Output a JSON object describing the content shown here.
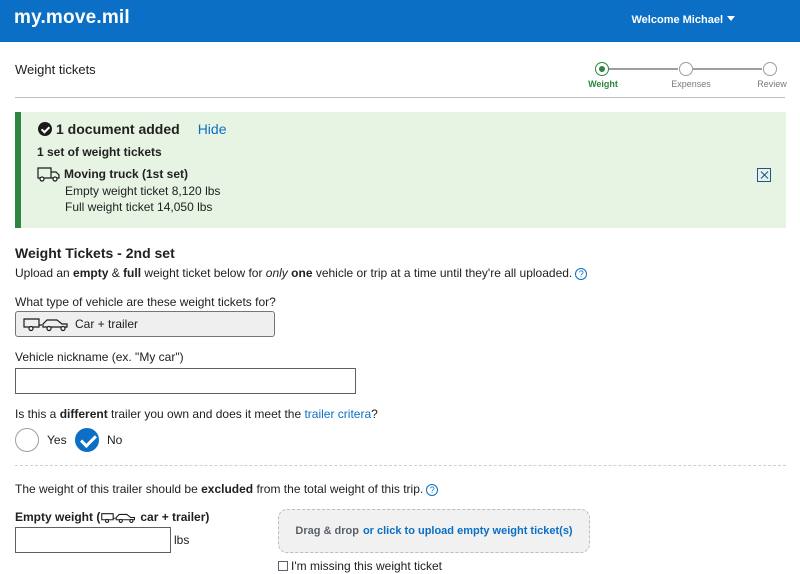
{
  "header": {
    "brand": "my.move.mil",
    "welcome": "Welcome Michael",
    "background_color": "#0b6fc5"
  },
  "page": {
    "title": "Weight tickets"
  },
  "stepper": {
    "steps": [
      {
        "label": "Weight",
        "state": "active"
      },
      {
        "label": "Expenses",
        "state": "pending"
      },
      {
        "label": "Review",
        "state": "pending"
      }
    ],
    "active_color": "#2e8540"
  },
  "alert": {
    "heading": "1 document added",
    "hide_link": "Hide",
    "subheading": "1 set of weight tickets",
    "item": {
      "icon": "truck-icon",
      "title": "Moving truck (1st set)",
      "empty_ticket": "Empty weight ticket 8,120 lbs",
      "full_ticket": "Full weight ticket 14,050 lbs"
    },
    "background_color": "#e7f4e4"
  },
  "form": {
    "section_title": "Weight Tickets - 2nd set",
    "instructions": {
      "part1": "Upload an ",
      "empty": "empty",
      "amp": " & ",
      "full": "full",
      "part2": " weight ticket below for ",
      "only": "only",
      "space": " ",
      "one": "one",
      "part3": " vehicle or trip at a time until they're all uploaded."
    },
    "vehicle_type_label": "What type of vehicle are these weight tickets for?",
    "vehicle_type_value": "Car + trailer",
    "nickname_label": "Vehicle nickname (ex. \"My car\")",
    "nickname_value": "",
    "trailer_question": {
      "part1": "Is this a ",
      "different": "different",
      "part2": " trailer you own and does it meet the ",
      "link": "trailer critera",
      "part3": "?"
    },
    "radio_yes": "Yes",
    "radio_no": "No",
    "selected_option": "No",
    "excluded_note": {
      "part1": "The weight of this trailer should be ",
      "excluded": "excluded",
      "part2": " from the total weight of this trip."
    },
    "empty_weight_label_prefix": "Empty weight (",
    "empty_weight_label_suffix": " car + trailer)",
    "weight_unit": "lbs",
    "weight_value": "",
    "dropzone_text": "Drag & drop",
    "dropzone_link": "or click to upload empty weight ticket(s)",
    "missing_ticket_label": "I'm missing this weight ticket",
    "missing_ticket_checked": false
  }
}
